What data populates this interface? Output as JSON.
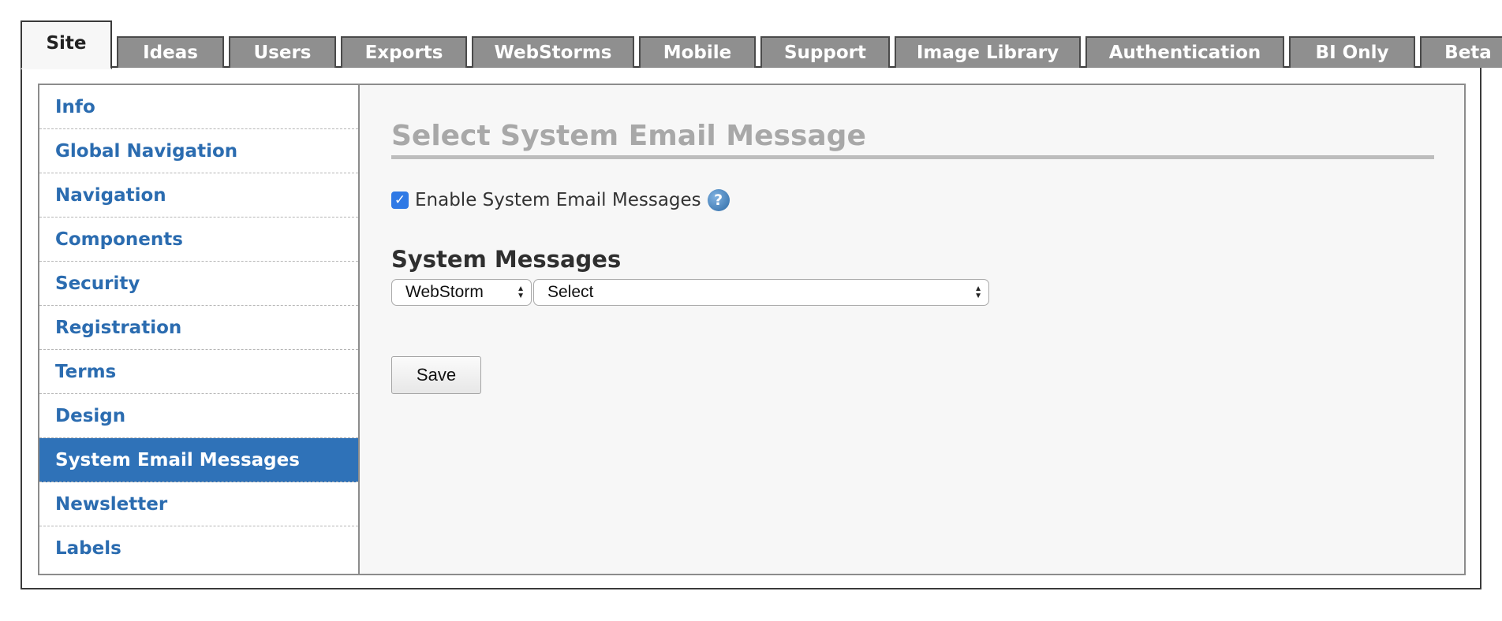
{
  "tabs": [
    {
      "label": "Site",
      "active": true
    },
    {
      "label": "Ideas"
    },
    {
      "label": "Users"
    },
    {
      "label": "Exports"
    },
    {
      "label": "WebStorms"
    },
    {
      "label": "Mobile"
    },
    {
      "label": "Support"
    },
    {
      "label": "Image Library"
    },
    {
      "label": "Authentication"
    },
    {
      "label": "BI Only"
    },
    {
      "label": "Beta"
    }
  ],
  "sidebar": {
    "items": [
      {
        "label": "Info"
      },
      {
        "label": "Global Navigation"
      },
      {
        "label": "Navigation"
      },
      {
        "label": "Components"
      },
      {
        "label": "Security"
      },
      {
        "label": "Registration"
      },
      {
        "label": "Terms"
      },
      {
        "label": "Design"
      },
      {
        "label": "System Email Messages",
        "active": true
      },
      {
        "label": "Newsletter"
      },
      {
        "label": "Labels"
      }
    ]
  },
  "main": {
    "title": "Select System Email Message",
    "enable_checkbox": {
      "label": "Enable System Email Messages",
      "checked": true,
      "check_glyph": "✓"
    },
    "help_icon_glyph": "?",
    "section_title": "System Messages",
    "type_select": {
      "value": "WebStorm"
    },
    "message_select": {
      "value": "Select"
    },
    "select_arrows": {
      "up": "▲",
      "down": "▼"
    },
    "save_label": "Save"
  },
  "colors": {
    "accent": "#2f72b8",
    "link": "#2b6cb0",
    "tab_inactive": "#8f8f8f",
    "panel_bg": "#f7f7f7",
    "checkbox": "#2f7ae5"
  }
}
